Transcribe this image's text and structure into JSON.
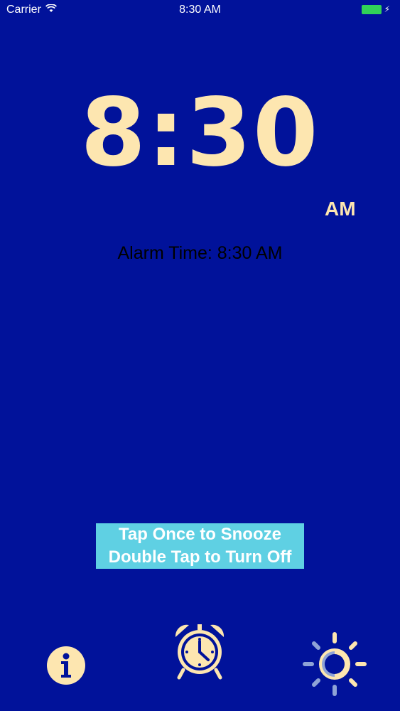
{
  "status_bar": {
    "carrier": "Carrier",
    "time": "8:30 AM",
    "wifi_icon": "wifi-icon",
    "battery_icon": "battery-icon",
    "charging_icon": "charging-bolt-icon"
  },
  "clock": {
    "time": "8:30",
    "period": "AM"
  },
  "alarm": {
    "label": "Alarm Time: 8:30 AM"
  },
  "instructions": {
    "line1": "Tap Once to Snooze",
    "line2": "Double Tap to Turn Off"
  },
  "toolbar": {
    "info_icon": "info-icon",
    "alarm_icon": "alarm-clock-icon",
    "brightness_icon": "brightness-icon"
  },
  "colors": {
    "background": "#01129a",
    "clock_text": "#fde6b0",
    "instruction_bg": "#5fd0e3",
    "battery": "#31d158"
  }
}
